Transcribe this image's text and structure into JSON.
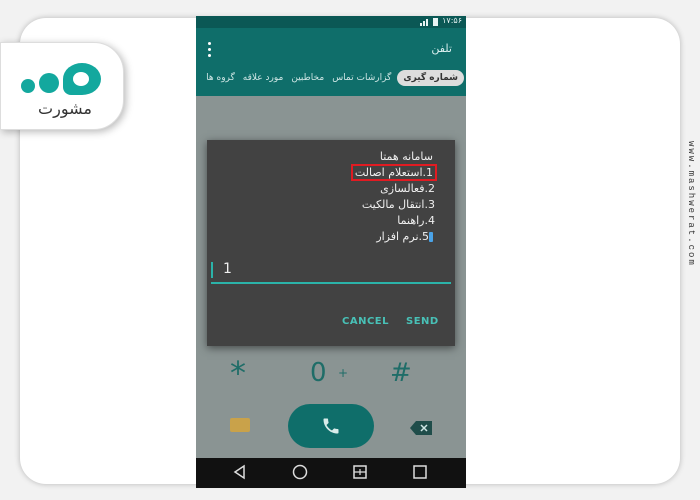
{
  "watermark": {
    "url": "www.mashwerat.com"
  },
  "logo": {
    "text": "مشورت"
  },
  "status_bar": {
    "time": "۱۷:۵۶"
  },
  "app_bar": {
    "title": "تلفن",
    "menu_icon": "kebab-menu-icon"
  },
  "tabs": [
    {
      "label": "شماره گیری",
      "active": true
    },
    {
      "label": "گزارشات تماس",
      "active": false
    },
    {
      "label": "مخاطبین",
      "active": false
    },
    {
      "label": "مورد علاقه",
      "active": false
    },
    {
      "label": "گروه ها",
      "active": false
    }
  ],
  "dialog": {
    "title": "سامانه همتا",
    "options": [
      "1.استعلام اصالت",
      "2.فعالسازی",
      "3.انتقال مالکیت",
      "4.راهنما",
      "5.نرم افزار"
    ],
    "reply_value": "1",
    "cancel_label": "CANCEL",
    "send_label": "SEND"
  },
  "dialpad": {
    "star": "*",
    "zero": "0",
    "plus": "+",
    "hash": "#"
  },
  "colors": {
    "accent": "#48c1b7",
    "app_bar": "#0f6e6a",
    "highlight": "#e11b22",
    "brand": "#13a89e"
  }
}
